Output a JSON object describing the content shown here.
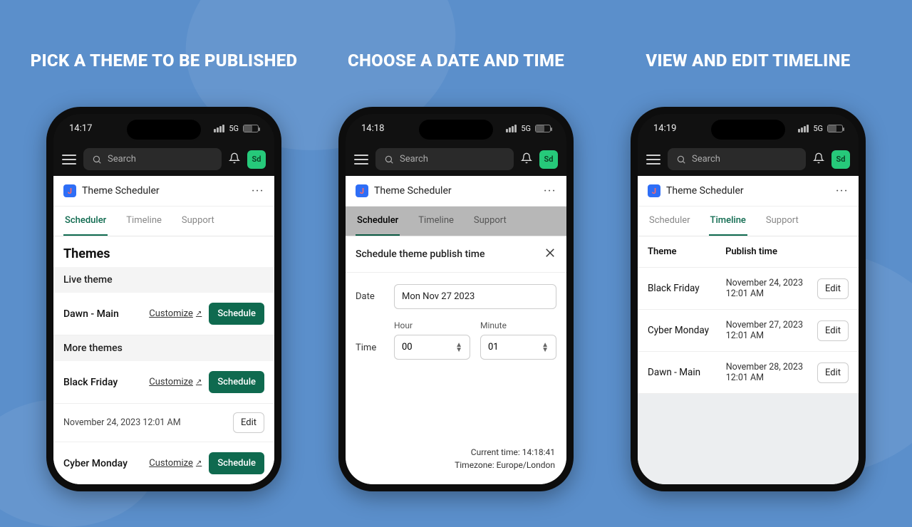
{
  "headlines": [
    "PICK A THEME TO BE PUBLISHED",
    "CHOOSE A DATE AND TIME",
    "VIEW AND EDIT TIMELINE"
  ],
  "status_times": [
    "14:17",
    "14:18",
    "14:19"
  ],
  "net_label": "5G",
  "topbar": {
    "search_placeholder": "Search",
    "avatar": "Sd"
  },
  "app": {
    "title": "Theme Scheduler"
  },
  "tabs": [
    "Scheduler",
    "Timeline",
    "Support"
  ],
  "labels": {
    "themes": "Themes",
    "live_theme": "Live theme",
    "more_themes": "More themes",
    "customize": "Customize",
    "schedule": "Schedule",
    "edit": "Edit",
    "date": "Date",
    "time": "Time",
    "hour": "Hour",
    "minute": "Minute"
  },
  "phone1": {
    "live": {
      "name": "Dawn - Main"
    },
    "more": [
      {
        "name": "Black Friday",
        "scheduled": "November 24, 2023 12:01 AM"
      },
      {
        "name": "Cyber Monday"
      }
    ]
  },
  "phone2": {
    "modal_title": "Schedule theme publish time",
    "date_value": "Mon Nov 27 2023",
    "hour_value": "00",
    "minute_value": "01",
    "footer_time": "Current time: 14:18:41",
    "footer_tz": "Timezone: Europe/London"
  },
  "phone3": {
    "col_theme": "Theme",
    "col_publish": "Publish time",
    "rows": [
      {
        "theme": "Black Friday",
        "time": "November 24, 2023 12:01 AM"
      },
      {
        "theme": "Cyber Monday",
        "time": "November 27, 2023 12:01 AM"
      },
      {
        "theme": "Dawn - Main",
        "time": "November 28, 2023 12:01 AM"
      }
    ]
  }
}
